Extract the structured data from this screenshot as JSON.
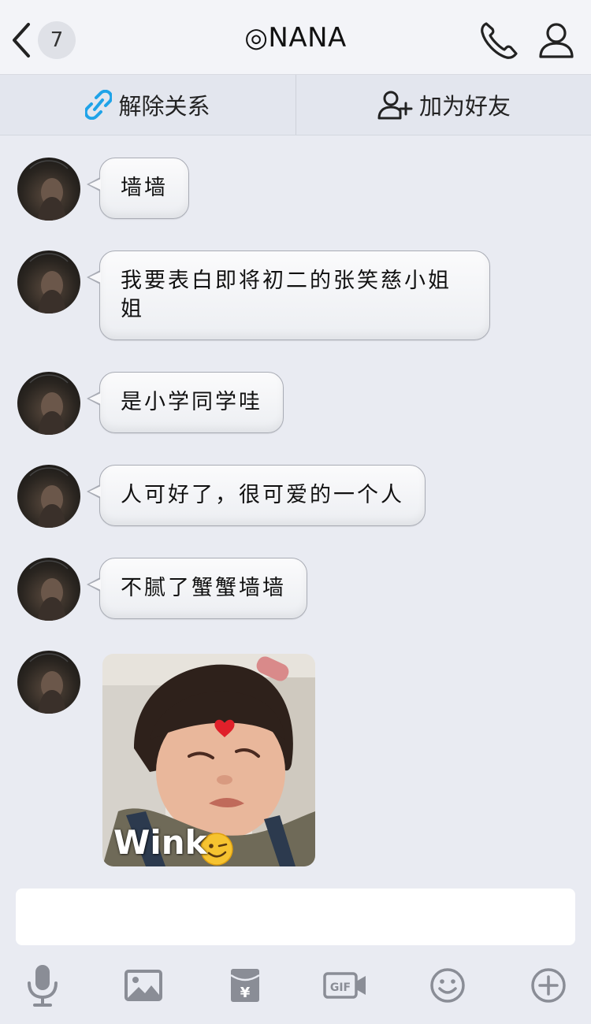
{
  "header": {
    "unread_count": "7",
    "title": "◎NANA"
  },
  "actions": {
    "unlink_label": "解除关系",
    "add_friend_label": "加为好友"
  },
  "messages": [
    {
      "type": "text",
      "text": "墙墙"
    },
    {
      "type": "text",
      "text": "我要表白即将初二的张笑慈小姐姐"
    },
    {
      "type": "text",
      "text": "是小学同学哇"
    },
    {
      "type": "text",
      "text": "人可好了，很可爱的一个人"
    },
    {
      "type": "text",
      "text": "不腻了蟹蟹墙墙"
    },
    {
      "type": "sticker",
      "caption": "Wink"
    }
  ],
  "input": {
    "value": "",
    "placeholder": ""
  },
  "toolbar": [
    "microphone-icon",
    "image-icon",
    "red-packet-icon",
    "gif-icon",
    "emoji-icon",
    "plus-icon"
  ],
  "colors": {
    "background": "#e9ebf2",
    "header": "#f3f4f8",
    "action_bar": "#e3e6ee",
    "unlink_icon": "#1fa3e8",
    "icon_gray": "#8a8d96"
  }
}
